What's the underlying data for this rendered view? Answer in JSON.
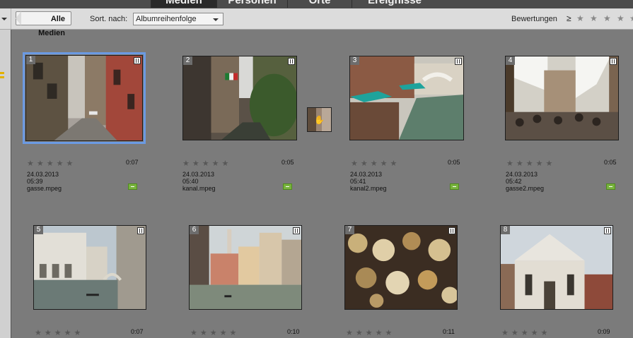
{
  "tabs": [
    "Medien",
    "Personen",
    "Orte",
    "Ereignisse"
  ],
  "toolbar": {
    "back_label": "Alle Medien",
    "sort_label": "Sort. nach:",
    "sort_value": "Albumreihenfolge",
    "rating_label": "Bewertungen",
    "rating_op": "≥",
    "star_glyph": "★"
  },
  "items": [
    {
      "num": "1",
      "duration": "0:07",
      "date": "24.03.2013 05:39",
      "filename": "gasse.mpeg"
    },
    {
      "num": "2",
      "duration": "0:05",
      "date": "24.03.2013 05:40",
      "filename": "kanal.mpeg"
    },
    {
      "num": "3",
      "duration": "0:05",
      "date": "24.03.2013 05:41",
      "filename": "kanal2.mpeg"
    },
    {
      "num": "4",
      "duration": "0:05",
      "date": "24.03.2013 05:42",
      "filename": "gasse2.mpeg"
    },
    {
      "num": "5",
      "duration": "0:07"
    },
    {
      "num": "6",
      "duration": "0:10"
    },
    {
      "num": "7",
      "duration": "0:11"
    },
    {
      "num": "8",
      "duration": "0:09"
    }
  ],
  "stars_text": "★★★★★",
  "colors": {
    "accent_selection": "#6b9ae3",
    "badge_green": "#78b33d",
    "grid_bg": "#7b7b7b"
  }
}
